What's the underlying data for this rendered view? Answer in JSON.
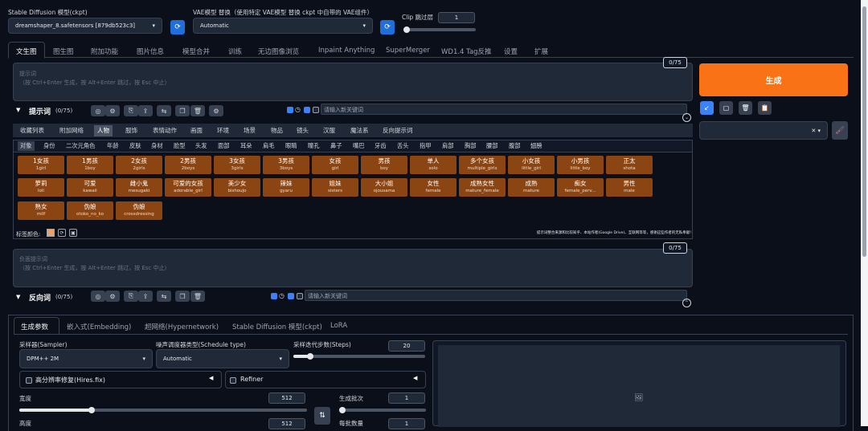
{
  "top": {
    "sd_model_label": "Stable Diffusion 模型(ckpt)",
    "sd_model_value": "dreamshaper_8.safetensors [879db523c3]",
    "vae_label": "VAE模型 替换（使用特定 VAE模型 替换 ckpt 中自带的 VAE组件）",
    "vae_value": "Automatic",
    "clip_label": "Clip 跳过层",
    "clip_value": "1"
  },
  "tabs": [
    "文生图",
    "图生图",
    "附加功能",
    "图片信息",
    "模型合并",
    "训练",
    "无边图像浏览",
    "Inpaint Anything",
    "SuperMerger",
    "WD1.4 Tag反推",
    "设置",
    "扩展"
  ],
  "prompt": {
    "counter": "0/75",
    "placeholder_line1": "提示词",
    "placeholder_line2": "（按 Ctrl+Enter 生成，按 Alt+Enter 跳过，按 Esc 中止）",
    "label": "提示词",
    "count": "(0/75)",
    "keyword_placeholder": "请输入新关键词"
  },
  "generate_label": "生成",
  "categories": [
    "收藏列表",
    "附加网络",
    "人物",
    "服饰",
    "表情动作",
    "画面",
    "环境",
    "场景",
    "物品",
    "镜头",
    "汉服",
    "魔法系",
    "反向提示词"
  ],
  "subcategories": [
    "对象",
    "身份",
    "二次元角色",
    "年龄",
    "皮肤",
    "身材",
    "脸型",
    "头发",
    "面部",
    "耳朵",
    "肩毛",
    "眼睛",
    "瞳孔",
    "鼻子",
    "嘴巴",
    "牙齿",
    "舌头",
    "指甲",
    "肩部",
    "胸部",
    "腰部",
    "腹部",
    "翅膀"
  ],
  "tags": [
    {
      "cn": "1女孩",
      "en": "1girl"
    },
    {
      "cn": "1男孩",
      "en": "1boy"
    },
    {
      "cn": "2女孩",
      "en": "2girls"
    },
    {
      "cn": "2男孩",
      "en": "2boys"
    },
    {
      "cn": "3女孩",
      "en": "3girls"
    },
    {
      "cn": "3男孩",
      "en": "3boys"
    },
    {
      "cn": "女孩",
      "en": "girl"
    },
    {
      "cn": "男孩",
      "en": "boy"
    },
    {
      "cn": "单人",
      "en": "solo"
    },
    {
      "cn": "多个女孩",
      "en": "multiple_girls"
    },
    {
      "cn": "小女孩",
      "en": "little_girl"
    },
    {
      "cn": "小男孩",
      "en": "little_boy"
    },
    {
      "cn": "正太",
      "en": "shota"
    },
    {
      "cn": "萝莉",
      "en": "loli"
    },
    {
      "cn": "可爱",
      "en": "kawaii"
    },
    {
      "cn": "雌小鬼",
      "en": "mesugaki"
    },
    {
      "cn": "可爱的女孩",
      "en": "adorable_girl"
    },
    {
      "cn": "美少女",
      "en": "bishoujo"
    },
    {
      "cn": "辣妹",
      "en": "gyaru"
    },
    {
      "cn": "姐妹",
      "en": "sisters"
    },
    {
      "cn": "大小姐",
      "en": "ojousama"
    },
    {
      "cn": "女性",
      "en": "female"
    },
    {
      "cn": "成熟女性",
      "en": "mature_female"
    },
    {
      "cn": "成熟",
      "en": "mature"
    },
    {
      "cn": "痴女",
      "en": "female_perv..."
    },
    {
      "cn": "男性",
      "en": "male"
    },
    {
      "cn": "熟女",
      "en": "milf"
    },
    {
      "cn": "伪娘",
      "en": "otoko_no_ko"
    },
    {
      "cn": "伪娘",
      "en": "crossdressing"
    }
  ],
  "tag_color_label": "标签颜色:",
  "credit_text": "提示词整合来源和比较知乎、本站作者(Google Drive)、互联网等等，感谢这些作者的无私奉献!",
  "negative": {
    "counter": "0/75",
    "placeholder_line1": "负面提示词",
    "placeholder_line2": "（按 Ctrl+Enter 生成，按 Alt+Enter 跳过，按 Esc 中止）",
    "label": "反向词",
    "count": "(0/75)",
    "keyword_placeholder": "请输入新关键词"
  },
  "param_tabs": [
    "生成参数",
    "嵌入式(Embedding)",
    "超网络(Hypernetwork)",
    "Stable Diffusion 模型(ckpt)",
    "LoRA"
  ],
  "params": {
    "sampler_label": "采样器(Sampler)",
    "sampler_value": "DPM++ 2M",
    "schedule_label": "噪声调度器类型(Schedule type)",
    "schedule_value": "Automatic",
    "steps_label": "采样迭代步数(Steps)",
    "steps_value": "20",
    "steps_fraction": 0.13,
    "hires_label": "高分辨率修复(Hires.fix)",
    "refiner_label": "Refiner",
    "width_label": "宽度",
    "width_value": "512",
    "width_fraction": 0.25,
    "batch_count_label": "生成批次",
    "batch_count_value": "1",
    "height_label": "高度",
    "height_value": "512",
    "batch_size_label": "每批数量",
    "batch_size_value": "1"
  }
}
